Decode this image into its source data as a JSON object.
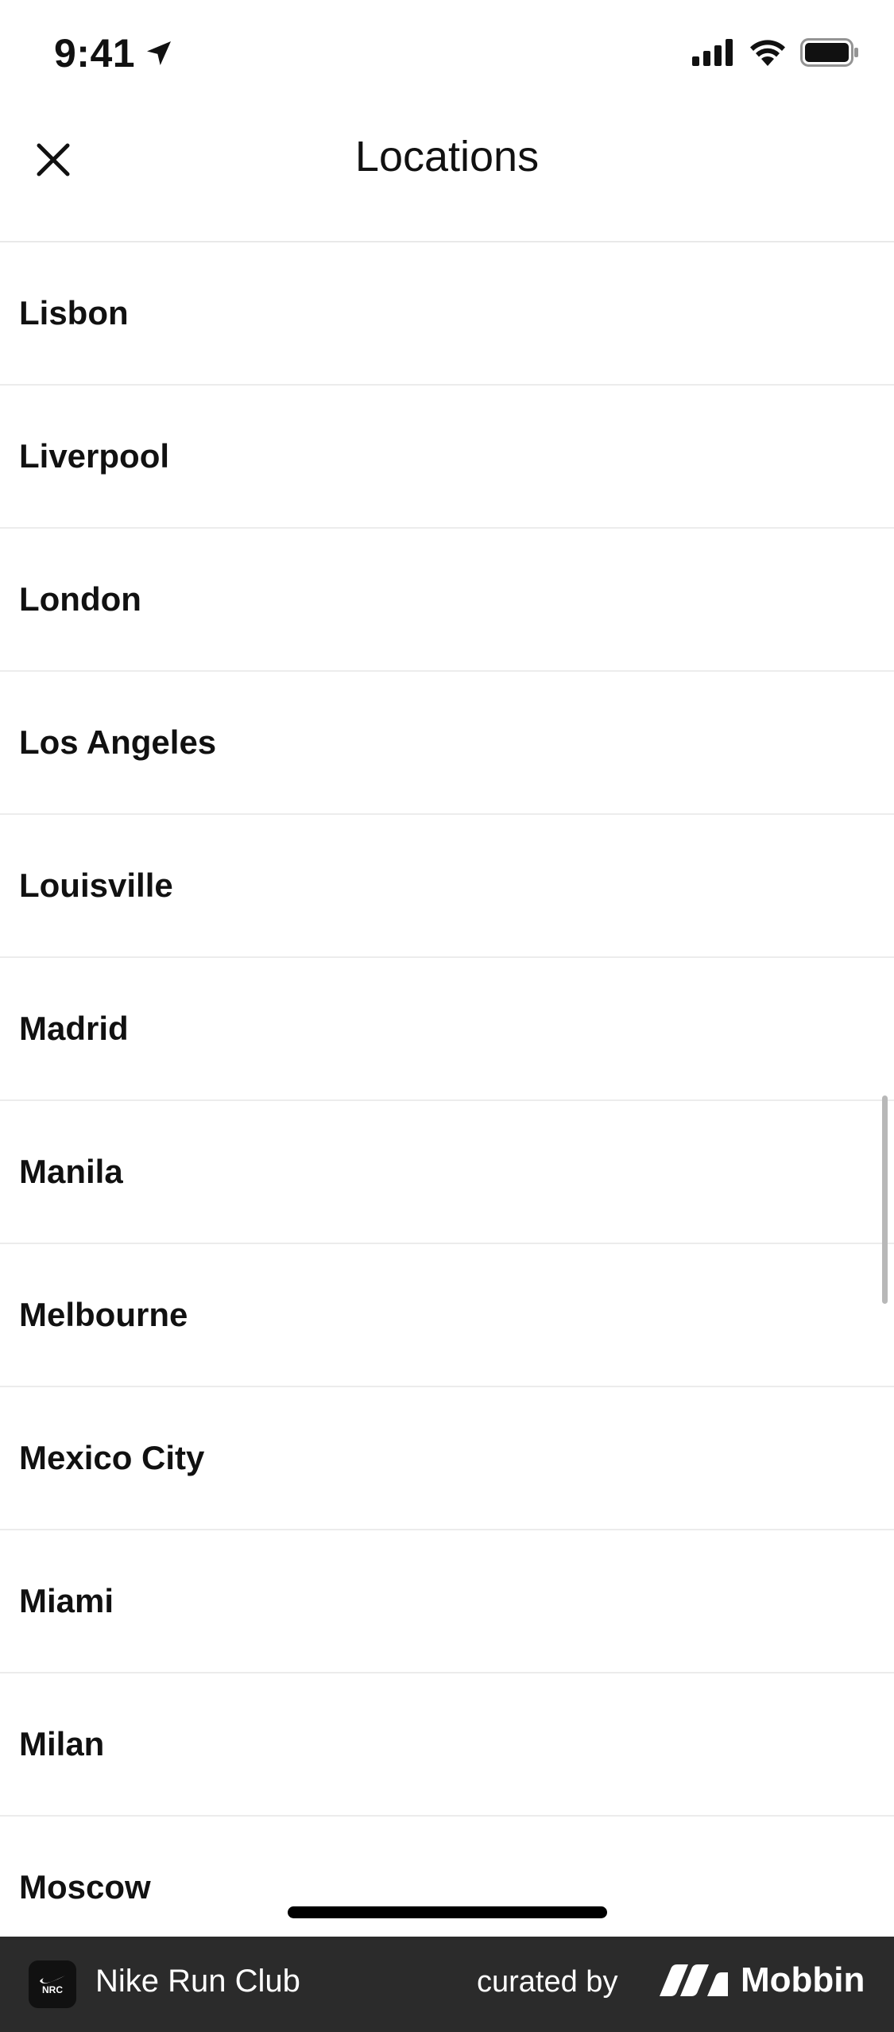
{
  "status_bar": {
    "time": "9:41"
  },
  "header": {
    "title": "Locations"
  },
  "locations": [
    "Lisbon",
    "Liverpool",
    "London",
    "Los Angeles",
    "Louisville",
    "Madrid",
    "Manila",
    "Melbourne",
    "Mexico City",
    "Miami",
    "Milan",
    "Moscow"
  ],
  "brand_bar": {
    "app_icon_text": "NRC",
    "app_name": "Nike Run Club",
    "curated_by": "curated by",
    "brand": "Mobbin"
  }
}
